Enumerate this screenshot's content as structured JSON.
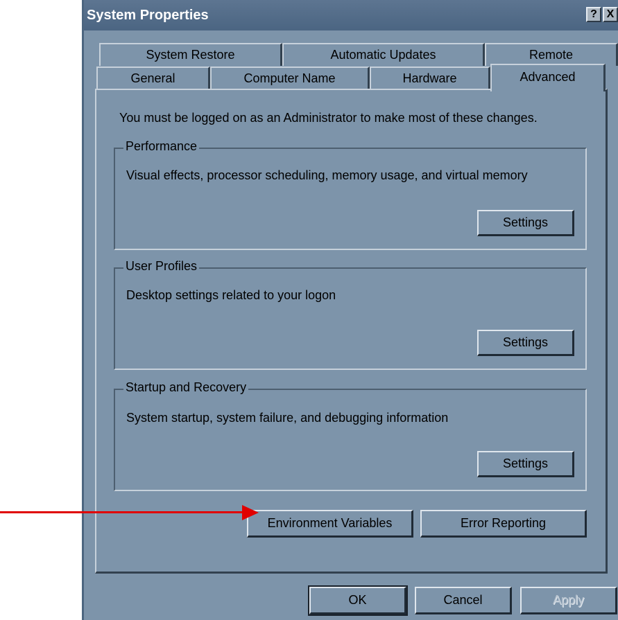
{
  "window": {
    "title": "System Properties",
    "help_button": "?",
    "close_button": "X"
  },
  "tabs": {
    "row1": [
      "System Restore",
      "Automatic Updates",
      "Remote"
    ],
    "row2": [
      "General",
      "Computer Name",
      "Hardware",
      "Advanced"
    ],
    "active": "Advanced"
  },
  "advanced": {
    "notice": "You must be logged on as an Administrator to make most of these changes.",
    "performance": {
      "title": "Performance",
      "description": "Visual effects, processor scheduling, memory usage, and virtual memory",
      "button": "Settings"
    },
    "user_profiles": {
      "title": "User Profiles",
      "description": "Desktop settings related to your logon",
      "button": "Settings"
    },
    "startup_recovery": {
      "title": "Startup and Recovery",
      "description": "System startup, system failure, and debugging information",
      "button": "Settings"
    },
    "env_vars_button": "Environment Variables",
    "error_reporting_button": "Error Reporting"
  },
  "footer": {
    "ok": "OK",
    "cancel": "Cancel",
    "apply": "Apply"
  },
  "colors": {
    "window_bg": "#7d94aa",
    "title_bg": "#4b6582",
    "annotation_arrow": "#e00000"
  }
}
